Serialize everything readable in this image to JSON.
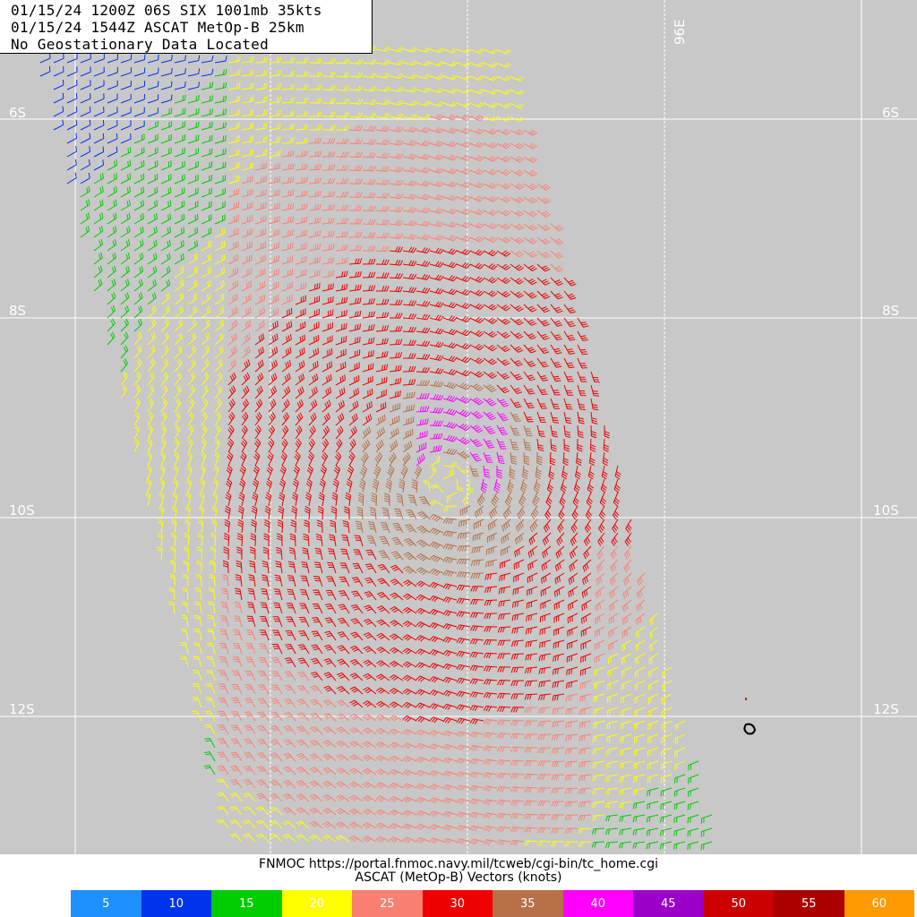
{
  "header": {
    "line1": "01/15/24 1200Z  06S SIX 1001mb 35kts",
    "line2": "01/15/24 1544Z  ASCAT MetOp-B 25km",
    "line3": "No Geostationary Data Located"
  },
  "map": {
    "background_color": "#c8c8c8",
    "grid_color": "#ffffff",
    "lat_labels": [
      "6S",
      "8S",
      "10S",
      "12S"
    ],
    "lon_labels": [
      "96E"
    ],
    "storm_center": {
      "lat": "9.9S",
      "lon": "96.0E"
    }
  },
  "footer": {
    "credit": "FNMOC https://portal.fnmoc.navy.mil/tcweb/cgi-bin/tc_home.cgi",
    "legend_title": "ASCAT (MetOp-B) Vectors (knots)"
  },
  "legend": [
    {
      "label": "5",
      "color": "#1e90ff"
    },
    {
      "label": "10",
      "color": "#0033ee"
    },
    {
      "label": "15",
      "color": "#00cc00"
    },
    {
      "label": "20",
      "color": "#ffff00"
    },
    {
      "label": "25",
      "color": "#fa8072"
    },
    {
      "label": "30",
      "color": "#ee0000"
    },
    {
      "label": "35",
      "color": "#b87048"
    },
    {
      "label": "40",
      "color": "#ff00ff"
    },
    {
      "label": "45",
      "color": "#9a00c8"
    },
    {
      "label": "50",
      "color": "#cc0000"
    },
    {
      "label": "55",
      "color": "#aa0000"
    },
    {
      "label": "60",
      "color": "#ff9900"
    }
  ]
}
